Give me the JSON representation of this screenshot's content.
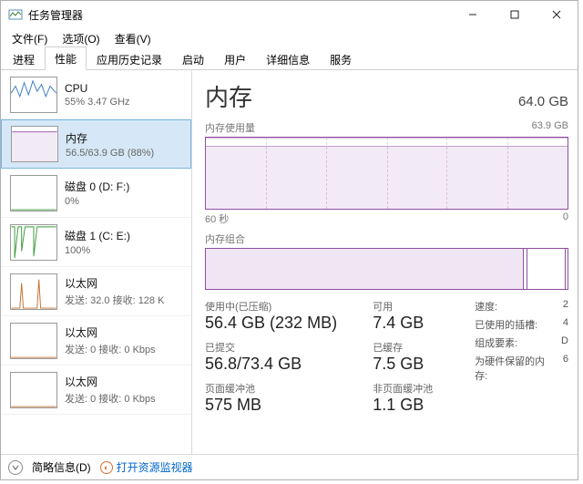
{
  "titlebar": {
    "title": "任务管理器"
  },
  "menubar": {
    "file": "文件(F)",
    "options": "选项(O)",
    "view": "查看(V)"
  },
  "tabs": {
    "processes": "进程",
    "performance": "性能",
    "app_history": "应用历史记录",
    "startup": "启动",
    "users": "用户",
    "details": "详细信息",
    "services": "服务"
  },
  "sidebar": {
    "items": [
      {
        "name": "cpu",
        "l1": "CPU",
        "l2": "55%  3.47 GHz"
      },
      {
        "name": "memory",
        "l1": "内存",
        "l2": "56.5/63.9 GB (88%)"
      },
      {
        "name": "disk0",
        "l1": "磁盘 0 (D: F:)",
        "l2": "0%"
      },
      {
        "name": "disk1",
        "l1": "磁盘 1 (C: E:)",
        "l2": "100%"
      },
      {
        "name": "eth0",
        "l1": "以太网",
        "l2": "发送: 32.0  接收: 128 K"
      },
      {
        "name": "eth1",
        "l1": "以太网",
        "l2": "发送: 0  接收: 0 Kbps"
      },
      {
        "name": "eth2",
        "l1": "以太网",
        "l2": "发送: 0  接收: 0 Kbps"
      }
    ]
  },
  "main": {
    "heading": "内存",
    "total": "64.0 GB",
    "usage_label": "内存使用量",
    "usage_max": "63.9 GB",
    "xaxis_left": "60 秒",
    "xaxis_right": "0",
    "composition_label": "内存组合",
    "stats": {
      "in_use_label": "使用中(已压缩)",
      "in_use_value": "56.4 GB (232 MB)",
      "available_label": "可用",
      "available_value": "7.4 GB",
      "committed_label": "已提交",
      "committed_value": "56.8/73.4 GB",
      "cached_label": "已缓存",
      "cached_value": "7.5 GB",
      "paged_label": "页面缓冲池",
      "paged_value": "575 MB",
      "nonpaged_label": "非页面缓冲池",
      "nonpaged_value": "1.1 GB"
    },
    "meta": {
      "speed_label": "速度:",
      "speed_value": "2",
      "slots_label": "已使用的插槽:",
      "slots_value": "4",
      "form_label": "组成要素:",
      "form_value": "D",
      "reserved_label": "为硬件保留的内存:",
      "reserved_value": "6"
    }
  },
  "footer": {
    "fewer_details": "简略信息(D)",
    "resmon": "打开资源监视器"
  },
  "chart_data": {
    "type": "area",
    "title": "内存使用量",
    "xlabel": "秒",
    "ylabel": "GB",
    "x_range_seconds": [
      60,
      0
    ],
    "ylim": [
      0,
      63.9
    ],
    "series": [
      {
        "name": "内存使用量 (GB)",
        "values": [
          56.2,
          56.3,
          56.3,
          56.3,
          56.4,
          56.4,
          56.4,
          56.4,
          56.4,
          56.4,
          56.4,
          56.4
        ]
      }
    ],
    "composition_gb": {
      "in_use": 56.4,
      "modified": 0.4,
      "standby": 7.1,
      "free": 0.0,
      "total": 63.9
    }
  }
}
